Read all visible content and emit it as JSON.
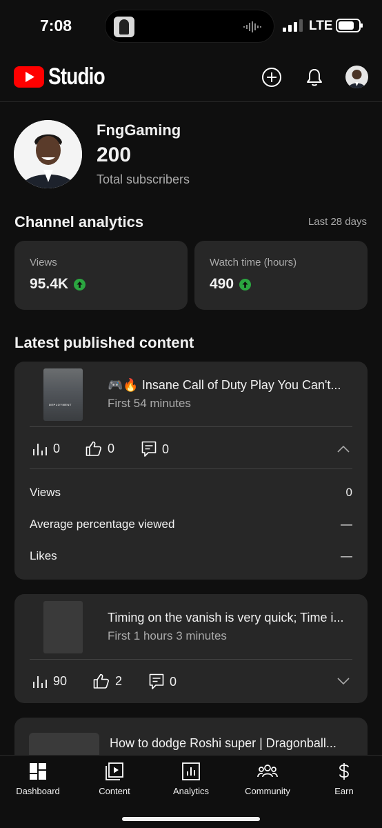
{
  "status_bar": {
    "time": "7:08",
    "carrier": "LTE"
  },
  "header": {
    "app_name": "Studio"
  },
  "channel": {
    "name": "FngGaming",
    "subscriber_count": "200",
    "subscriber_label": "Total subscribers"
  },
  "analytics": {
    "title": "Channel analytics",
    "range": "Last 28 days",
    "cards": [
      {
        "label": "Views",
        "value": "95.4K",
        "trend": "up"
      },
      {
        "label": "Watch time (hours)",
        "value": "490",
        "trend": "up"
      }
    ]
  },
  "latest": {
    "title": "Latest published content",
    "items": [
      {
        "title": "🎮🔥 Insane Call of Duty Play You Can't...",
        "subtitle": "First 54 minutes",
        "thumb_text": "DEPLOYMENT",
        "views": "0",
        "likes": "0",
        "comments": "0",
        "expanded": true,
        "details": [
          {
            "label": "Views",
            "value": "0"
          },
          {
            "label": "Average percentage viewed",
            "value": "—"
          },
          {
            "label": "Likes",
            "value": "—"
          }
        ]
      },
      {
        "title": "Timing on the vanish is very quick; Time i...",
        "subtitle": "First 1 hours 3 minutes",
        "views": "90",
        "likes": "2",
        "comments": "0",
        "expanded": false
      },
      {
        "title": "How to dodge Roshi super | Dragonball..."
      }
    ]
  },
  "bottom_nav": [
    {
      "label": "Dashboard",
      "icon": "dashboard-icon",
      "active": true
    },
    {
      "label": "Content",
      "icon": "content-icon"
    },
    {
      "label": "Analytics",
      "icon": "analytics-icon"
    },
    {
      "label": "Community",
      "icon": "community-icon"
    },
    {
      "label": "Earn",
      "icon": "dollar-icon"
    }
  ],
  "colors": {
    "background": "#0f0f0f",
    "card": "#272727",
    "brand_red": "#ff0000",
    "trend_green": "#2ba640",
    "muted_text": "#aaaaaa"
  }
}
